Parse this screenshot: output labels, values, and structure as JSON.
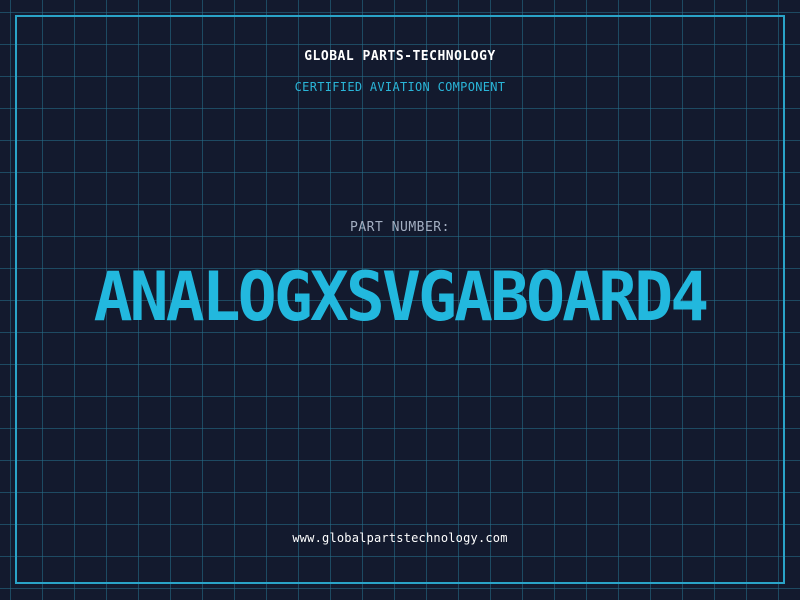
{
  "header": {
    "company": "GLOBAL PARTS-TECHNOLOGY",
    "subtitle": "CERTIFIED AVIATION COMPONENT"
  },
  "part": {
    "label": "PART NUMBER:",
    "number": "ANALOGXSVGABOARD4"
  },
  "footer": {
    "website": "www.globalpartstechnology.com"
  },
  "colors": {
    "background": "#131a2e",
    "grid": "#25708c",
    "accent": "#22b8de",
    "text": "#ffffff",
    "muted": "#a4afc2"
  }
}
